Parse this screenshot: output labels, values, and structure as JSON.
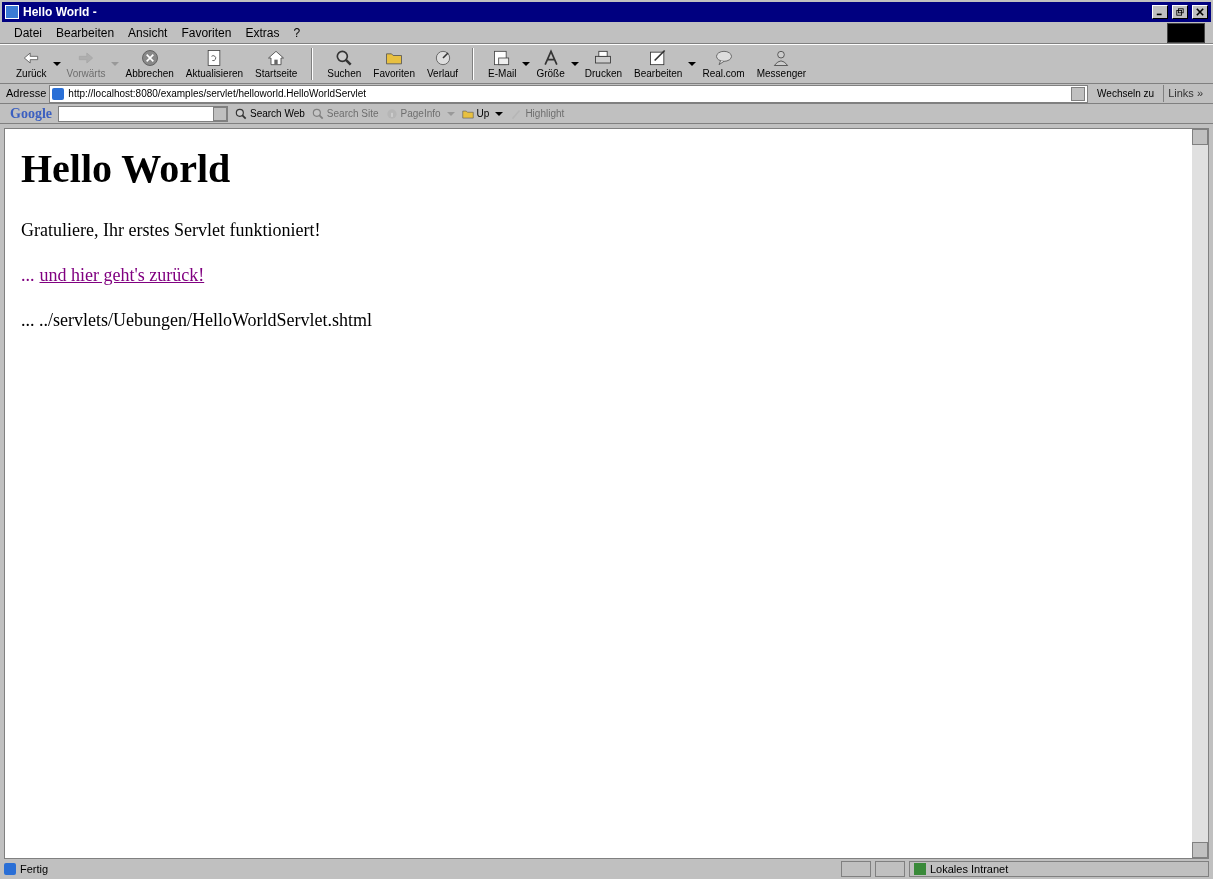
{
  "window": {
    "title": "Hello World -"
  },
  "menu": [
    "Datei",
    "Bearbeiten",
    "Ansicht",
    "Favoriten",
    "Extras",
    "?"
  ],
  "toolbar": [
    {
      "label": "Zurück",
      "disabled": false,
      "dropdown": true
    },
    {
      "label": "Vorwärts",
      "disabled": true,
      "dropdown": true
    },
    {
      "label": "Abbrechen",
      "disabled": false,
      "dropdown": false
    },
    {
      "label": "Aktualisieren",
      "disabled": false,
      "dropdown": false
    },
    {
      "label": "Startseite",
      "disabled": false,
      "dropdown": false
    },
    {
      "label": "Suchen",
      "disabled": false,
      "dropdown": false
    },
    {
      "label": "Favoriten",
      "disabled": false,
      "dropdown": false
    },
    {
      "label": "Verlauf",
      "disabled": false,
      "dropdown": false
    },
    {
      "label": "E-Mail",
      "disabled": false,
      "dropdown": true
    },
    {
      "label": "Größe",
      "disabled": false,
      "dropdown": true
    },
    {
      "label": "Drucken",
      "disabled": false,
      "dropdown": false
    },
    {
      "label": "Bearbeiten",
      "disabled": false,
      "dropdown": true
    },
    {
      "label": "Real.com",
      "disabled": false,
      "dropdown": false
    },
    {
      "label": "Messenger",
      "disabled": false,
      "dropdown": false
    }
  ],
  "address_bar": {
    "label": "Adresse",
    "value": "http://localhost:8080/examples/servlet/helloworld.HelloWorldServlet",
    "go": "Wechseln zu",
    "links": "Links »"
  },
  "google_toolbar": {
    "logo": "Google",
    "buttons": [
      {
        "label": "Search Web",
        "disabled": false,
        "dropdown": false
      },
      {
        "label": "Search Site",
        "disabled": true,
        "dropdown": false
      },
      {
        "label": "PageInfo",
        "disabled": true,
        "dropdown": true
      },
      {
        "label": "Up",
        "disabled": false,
        "dropdown": true
      },
      {
        "label": "Highlight",
        "disabled": true,
        "dropdown": false
      }
    ]
  },
  "page": {
    "heading": "Hello World",
    "paragraph": "Gratuliere, Ihr erstes Servlet funktioniert!",
    "link_prefix": "...",
    "link": "und hier geht's zurück!",
    "path": "... ../servlets/Uebungen/HelloWorldServlet.shtml"
  },
  "status_bar": {
    "text": "Fertig",
    "zone": "Lokales Intranet"
  }
}
